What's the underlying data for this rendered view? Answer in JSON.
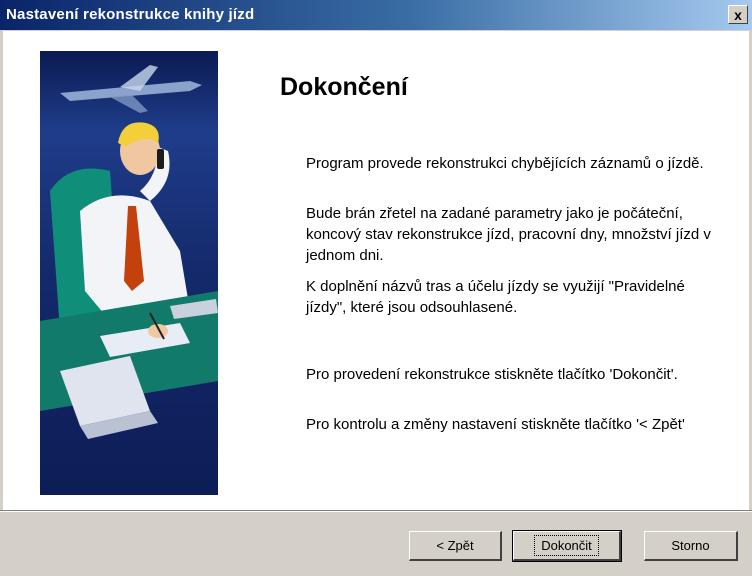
{
  "window": {
    "title": "Nastavení rekonstrukce knihy jízd",
    "close_label": "x"
  },
  "main": {
    "heading": "Dokončení",
    "paragraphs": [
      "Program provede rekonstrukci chybějících záznamů o jízdě.",
      "Bude brán zřetel na zadané parametry jako je počáteční, koncový stav rekonstrukce jízd, pracovní dny, množství jízd v jednom dni.",
      "K doplnění názvů tras a účelu jízdy se využijí \"Pravidelné jízdy\", které jsou odsouhlasené.",
      "Pro provedení rekonstrukce stiskněte tlačítko 'Dokončit'.",
      "Pro kontrolu a změny nastavení stiskněte tlačítko '< Zpět'"
    ]
  },
  "buttons": {
    "back": "< Zpět",
    "finish": "Dokončit",
    "cancel": "Storno"
  },
  "colors": {
    "titlebar_start": "#0a246a",
    "titlebar_end": "#a6caf0",
    "dialog_bg": "#d4d0c8",
    "side_panel": "#14296b"
  }
}
